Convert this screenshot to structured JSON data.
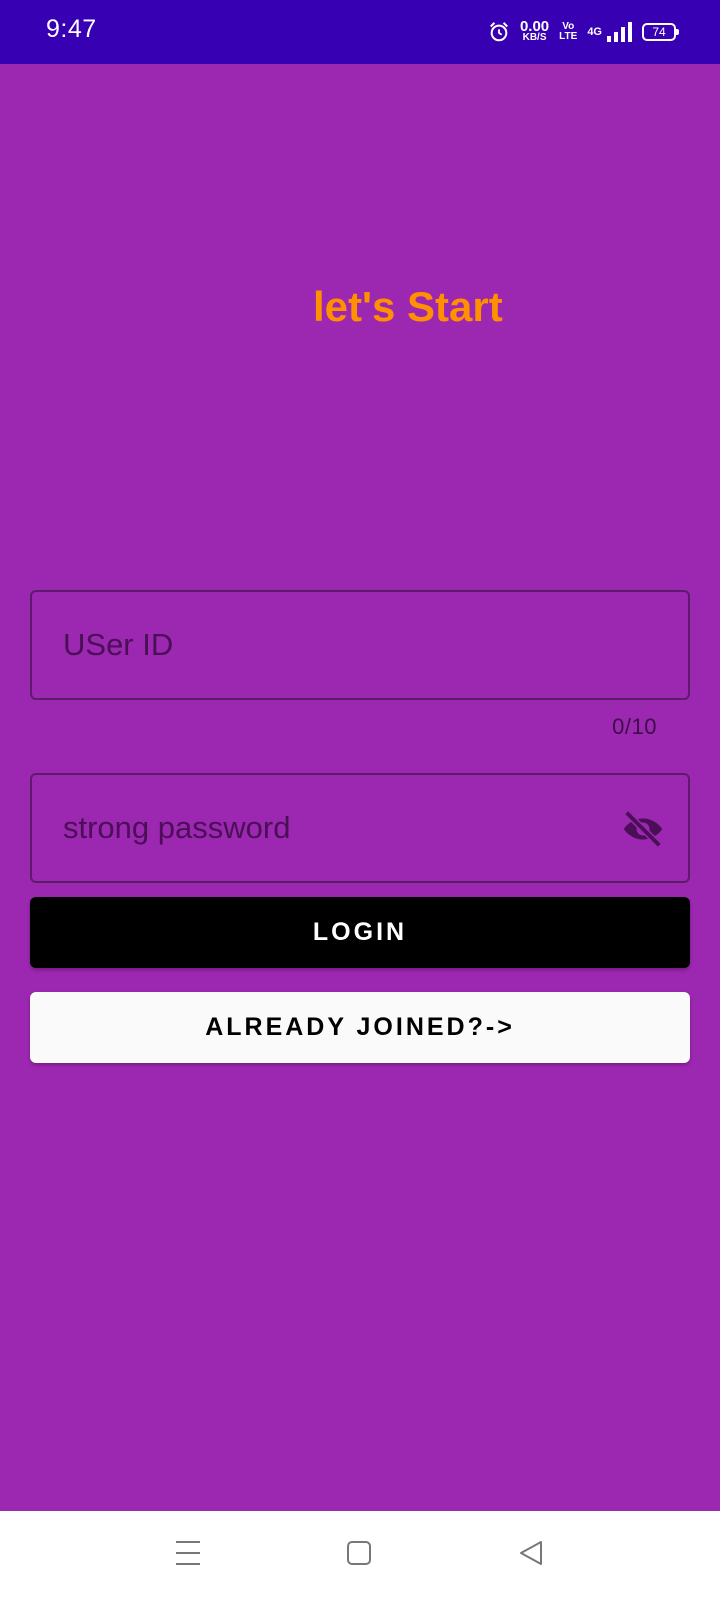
{
  "status_bar": {
    "time": "9:47",
    "speed_value": "0.00",
    "speed_unit": "KB/S",
    "volte_top": "Vo",
    "volte_bottom": "LTE",
    "network": "4G",
    "battery": "74",
    "icons": [
      "alarm-icon",
      "signal-icon",
      "battery-icon"
    ]
  },
  "title": "let's Start",
  "colors": {
    "background": "#9c27b0",
    "status_bar": "#3700b3",
    "title": "#ff9100",
    "login_button": "#000000",
    "secondary_button": "#fafafa"
  },
  "form": {
    "user_id": {
      "placeholder": "USer ID",
      "value": "",
      "counter": "0/10"
    },
    "password": {
      "placeholder": "strong password",
      "value": "",
      "toggle_icon": "eye-off-icon"
    }
  },
  "buttons": {
    "login": "LOGIN",
    "already_joined": "ALREADY JOINED?->"
  },
  "nav_bar": {
    "icons": [
      "menu-icon",
      "home-icon",
      "back-icon"
    ]
  }
}
